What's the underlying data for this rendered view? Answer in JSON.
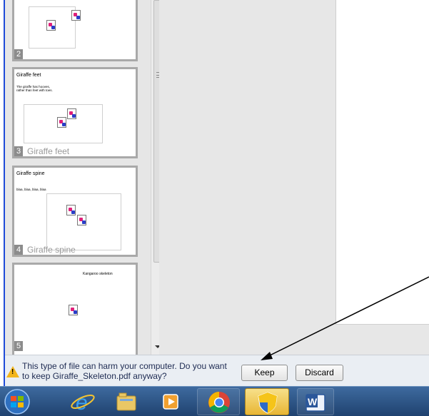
{
  "slides": [
    {
      "number": "2",
      "caption": ""
    },
    {
      "number": "3",
      "caption": "Giraffe feet",
      "title": "Giraffe feet",
      "body": [
        "The giraffe has hooves,",
        "rather than feet with toes."
      ]
    },
    {
      "number": "4",
      "caption": "Giraffe spine",
      "title": "Giraffe spine",
      "body": [
        "blaa, blaa, blaa, blaa"
      ]
    },
    {
      "number": "5",
      "caption": "",
      "title": "Kangaroo skeleton"
    }
  ],
  "download_bar": {
    "warning_icon": "warning-icon",
    "warning_glyph": "!",
    "message": "This type of file can harm your computer. Do you want to keep Giraffe_Skeleton.pdf anyway?",
    "keep_label": "Keep",
    "discard_label": "Discard"
  },
  "taskbar": {
    "items": [
      "start-orb",
      "internet-explorer-icon",
      "file-explorer-icon",
      "media-player-icon",
      "chrome-icon",
      "security-shield-icon",
      "word-icon"
    ],
    "word_letter": "W"
  },
  "colors": {
    "window_border": "#1f4bd8",
    "taskbar": "#2a5488",
    "warning": "#f3b51b",
    "annotation_arrow": "#000000"
  }
}
